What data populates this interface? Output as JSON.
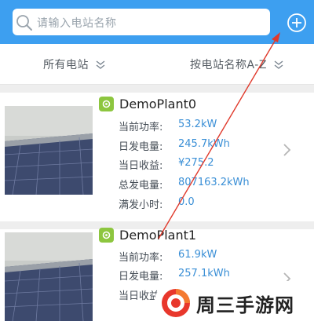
{
  "header": {
    "search_placeholder": "请输入电站名称",
    "accent_color": "#3d9ff0"
  },
  "filters": {
    "all_label": "所有电站",
    "sort_label": "按电站名称A-Z"
  },
  "plants": [
    {
      "name": "DemoPlant0",
      "stats": [
        {
          "label": "当前功率:",
          "value": "53.2kW"
        },
        {
          "label": "日发电量:",
          "value": "245.7kWh"
        },
        {
          "label": "当日收益:",
          "value": "¥275.2"
        },
        {
          "label": "总发电量:",
          "value": "807163.2kWh"
        },
        {
          "label": "满发小时:",
          "value": "0.0"
        }
      ]
    },
    {
      "name": "DemoPlant1",
      "stats": [
        {
          "label": "当前功率:",
          "value": "61.9kW"
        },
        {
          "label": "日发电量:",
          "value": "257.1kWh"
        },
        {
          "label": "当日收益:",
          "value": ""
        }
      ]
    }
  ],
  "watermark": {
    "text": "周三手游网"
  },
  "icons": [
    "search-icon",
    "add-circle-icon",
    "chevron-down-icon",
    "chevron-right-icon",
    "solar-plant-icon"
  ]
}
